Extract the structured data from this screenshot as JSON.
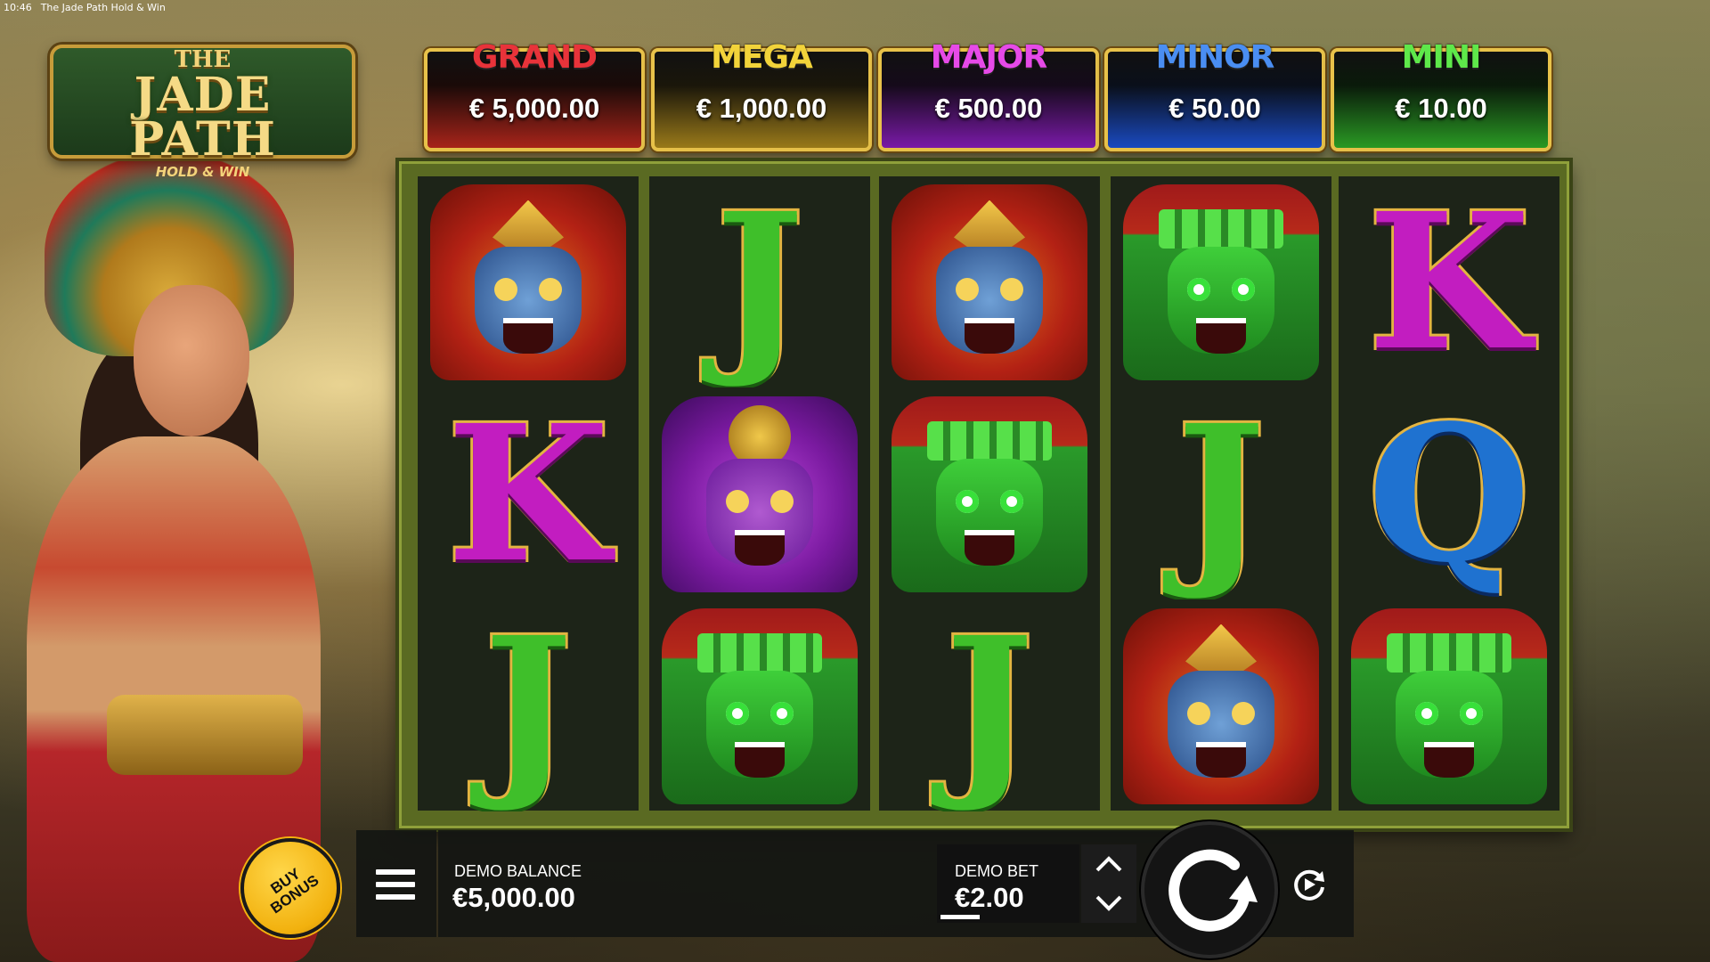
{
  "status_bar": {
    "time": "10:46",
    "window_title": "The Jade Path Hold & Win"
  },
  "logo": {
    "line1": "THE",
    "line2": "JADE PATH",
    "line3": "HOLD & WIN"
  },
  "jackpots": [
    {
      "name": "GRAND",
      "value": "€ 5,000.00",
      "color": "#e8333a"
    },
    {
      "name": "MEGA",
      "value": "€ 1,000.00",
      "color": "#f2d33a"
    },
    {
      "name": "MAJOR",
      "value": "€ 500.00",
      "color": "#e64ae8"
    },
    {
      "name": "MINOR",
      "value": "€ 50.00",
      "color": "#4a8ef2"
    },
    {
      "name": "MINI",
      "value": "€ 10.00",
      "color": "#5ee84a"
    }
  ],
  "reels": [
    [
      "eagle-mask",
      "K",
      "J"
    ],
    [
      "J",
      "jaguar-mask",
      "tiki-mask"
    ],
    [
      "eagle-mask",
      "tiki-mask",
      "J"
    ],
    [
      "tiki-mask",
      "J",
      "eagle-mask"
    ],
    [
      "K",
      "Q",
      "tiki-mask"
    ]
  ],
  "controls": {
    "buy_bonus": "BUY BONUS",
    "balance_label": "DEMO BALANCE",
    "balance_value": "€5,000.00",
    "bet_label": "DEMO BET",
    "bet_value": "€2.00",
    "menu_icon": "hamburger-menu-icon",
    "spin_icon": "spin-arrow-icon",
    "autoplay_icon": "autoplay-icon",
    "bet_up_icon": "chevron-up-icon",
    "bet_down_icon": "chevron-down-icon"
  }
}
